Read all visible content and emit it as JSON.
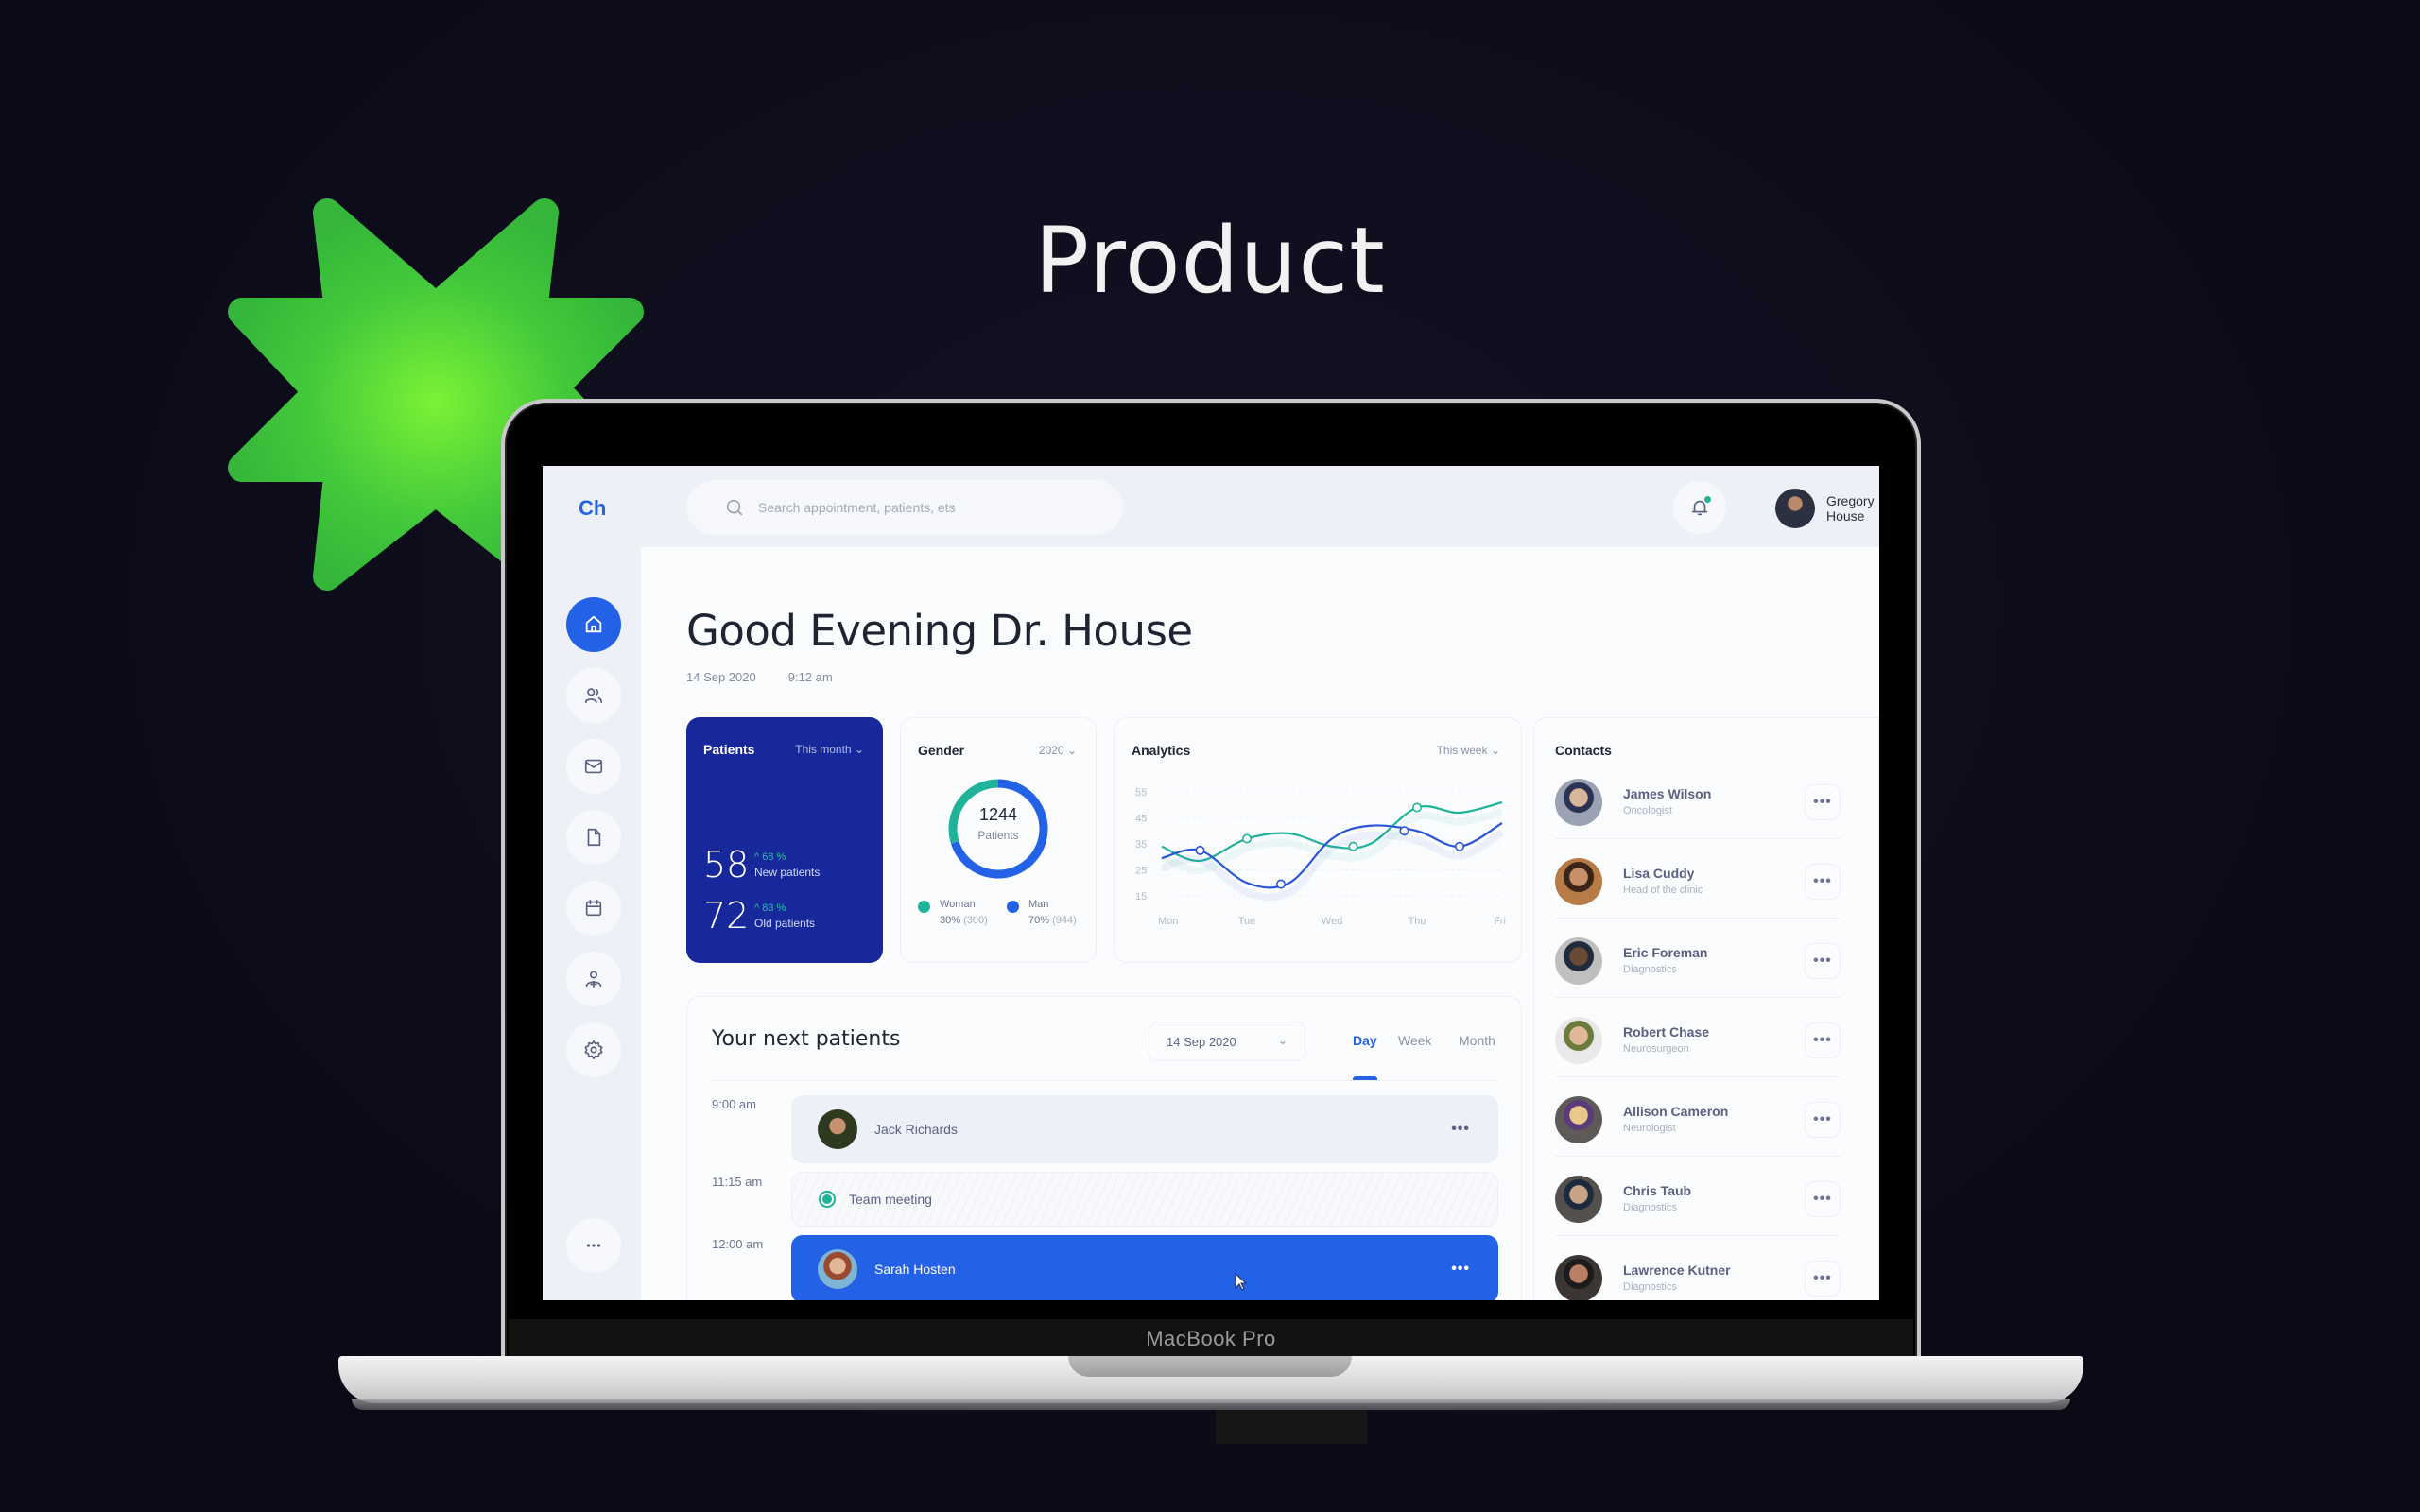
{
  "hero": {
    "title": "Product"
  },
  "device": {
    "label": "MacBook Pro"
  },
  "app": {
    "logo": "Ch",
    "search": {
      "placeholder": "Search appointment, patients, ets",
      "value": ""
    },
    "user": {
      "name": "Gregory House"
    },
    "notification": {
      "has_unread": true
    },
    "colors": {
      "primary": "#2361e6",
      "navy": "#17289a",
      "teal": "#1fb39a"
    },
    "sidebar": {
      "items": [
        {
          "name": "home",
          "icon": "home-icon",
          "active": true
        },
        {
          "name": "patients",
          "icon": "users-icon",
          "active": false
        },
        {
          "name": "messages",
          "icon": "mail-icon",
          "active": false
        },
        {
          "name": "documents",
          "icon": "file-icon",
          "active": false
        },
        {
          "name": "calendar",
          "icon": "calendar-icon",
          "active": false
        },
        {
          "name": "add-user",
          "icon": "user-plus-icon",
          "active": false
        },
        {
          "name": "settings",
          "icon": "gear-icon",
          "active": false
        }
      ],
      "more_icon": "more-horizontal-icon"
    },
    "greeting": {
      "title": "Good Evening Dr. House",
      "date": "14 Sep 2020",
      "time": "9:12 am"
    },
    "patients_card": {
      "title": "Patients",
      "filter": "This month",
      "stats": [
        {
          "value": "58",
          "delta": "^ 68 %",
          "label": "New patients"
        },
        {
          "value": "72",
          "delta": "^ 83 %",
          "label": "Old patients"
        }
      ]
    },
    "gender_card": {
      "title": "Gender",
      "filter": "2020",
      "total": "1244",
      "total_label": "Patients",
      "legend": [
        {
          "name": "Woman",
          "percent": "30%",
          "count": "(300)",
          "share": 0.3,
          "color": "#1fb39a"
        },
        {
          "name": "Man",
          "percent": "70%",
          "count": "(944)",
          "share": 0.7,
          "color": "#2361e6"
        }
      ]
    },
    "analytics_card": {
      "title": "Analytics",
      "filter": "This week"
    },
    "contacts": {
      "title": "Contacts",
      "items": [
        {
          "name": "James Wilson",
          "role": "Oncologist"
        },
        {
          "name": "Lisa Cuddy",
          "role": "Head of the clinic"
        },
        {
          "name": "Eric Foreman",
          "role": "Diagnostics"
        },
        {
          "name": "Robert Chase",
          "role": "Neurosurgeon"
        },
        {
          "name": "Allison Cameron",
          "role": "Neurologist"
        },
        {
          "name": "Chris Taub",
          "role": "Diagnostics"
        },
        {
          "name": "Lawrence Kutner",
          "role": "Diagnostics"
        }
      ],
      "more_label": "•••"
    },
    "next_patients": {
      "title": "Your next patients",
      "date_select": "14 Sep 2020",
      "tabs": [
        {
          "label": "Day",
          "active": true
        },
        {
          "label": "Week",
          "active": false
        },
        {
          "label": "Month",
          "active": false
        }
      ],
      "slots": [
        {
          "time": "9:00 am",
          "name": "Jack Richards",
          "type": "patient"
        },
        {
          "time": "11:15 am",
          "name": "Team meeting",
          "type": "meeting"
        },
        {
          "time": "12:00 am",
          "name": "Sarah Hosten",
          "type": "patient-active"
        }
      ],
      "more_label": "•••"
    }
  },
  "chart_data": {
    "type": "line",
    "title": "Analytics",
    "categories": [
      "Mon",
      "Tue",
      "Wed",
      "Thu",
      "Fri"
    ],
    "yticks": [
      15,
      25,
      35,
      45,
      55
    ],
    "ylim": [
      10,
      58
    ],
    "grid": true,
    "series": [
      {
        "name": "teal-series",
        "color": "#1fb39a",
        "x": [
          0,
          0.45,
          1,
          1.5,
          2,
          2.45,
          3,
          3.5,
          4
        ],
        "values": [
          34,
          28.5,
          37,
          39,
          34,
          35,
          49,
          47,
          51
        ],
        "markers": [
          [
            1,
            37
          ],
          [
            2.25,
            34
          ],
          [
            3.0,
            49
          ]
        ]
      },
      {
        "name": "blue-series",
        "color": "#2b55d6",
        "x": [
          0,
          0.45,
          1,
          1.5,
          2,
          2.45,
          3,
          3.5,
          4
        ],
        "values": [
          29.5,
          32.5,
          20,
          20,
          37,
          42,
          40,
          34,
          43
        ],
        "markers": [
          [
            0.45,
            32.5
          ],
          [
            1.4,
            19.5
          ],
          [
            2.85,
            40
          ],
          [
            3.5,
            34
          ]
        ]
      }
    ]
  }
}
